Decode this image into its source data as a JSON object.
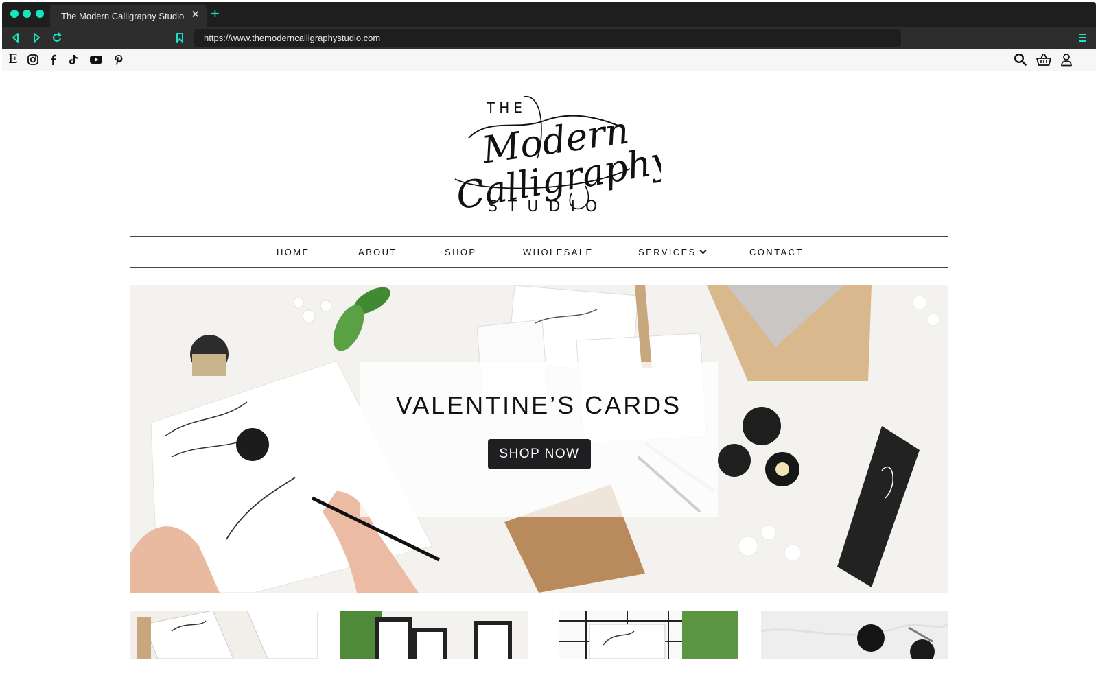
{
  "browser": {
    "tab_title": "The Modern Calligraphy Studio",
    "url": "https://www.themoderncalligraphystudio.com",
    "accent": "#18e3c2"
  },
  "social": {
    "etsy_glyph": "E",
    "icons": [
      "etsy-icon",
      "instagram-icon",
      "facebook-icon",
      "tiktok-icon",
      "youtube-icon",
      "pinterest-icon"
    ],
    "right_icons": [
      "search-icon",
      "basket-icon",
      "account-icon"
    ]
  },
  "logo": {
    "the": "THE",
    "script_line1": "Modern",
    "script_line2": "Calligraphy",
    "studio": "STUDIO"
  },
  "nav": {
    "items": [
      "HOME",
      "ABOUT",
      "SHOP",
      "WHOLESALE",
      "SERVICES",
      "CONTACT"
    ]
  },
  "hero": {
    "title": "VALENTINE’S CARDS",
    "button": "SHOP NOW"
  }
}
